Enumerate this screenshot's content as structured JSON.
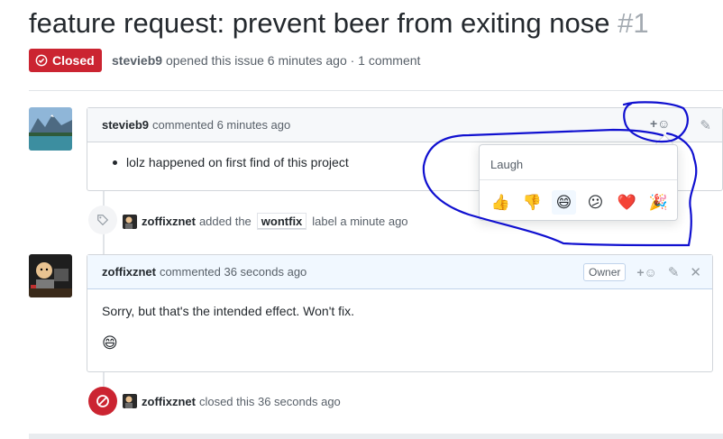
{
  "issue": {
    "title": "feature request: prevent beer from exiting nose",
    "number": "#1",
    "state": "Closed",
    "author": "stevieb9",
    "meta_text": "opened this issue 6 minutes ago · 1 comment"
  },
  "comments": [
    {
      "author": "stevieb9",
      "action": "commented 6 minutes ago",
      "body_list": [
        "lolz happened on first find of this project"
      ]
    },
    {
      "author": "zoffixznet",
      "action": "commented 36 seconds ago",
      "badge": "Owner",
      "body": "Sorry, but that's the intended effect. Won't fix.",
      "reaction_emoji": "😄"
    }
  ],
  "events": {
    "label_event": {
      "actor": "zoffixznet",
      "before": "added the",
      "label": "wontfix",
      "after": "label a minute ago"
    },
    "close_event": {
      "actor": "zoffixznet",
      "text": "closed this 36 seconds ago"
    }
  },
  "reaction_popover": {
    "tooltip": "Laugh",
    "reactions": [
      {
        "name": "thumbs-up",
        "glyph": "👍"
      },
      {
        "name": "thumbs-down",
        "glyph": "👎"
      },
      {
        "name": "laugh",
        "glyph": "😄"
      },
      {
        "name": "confused",
        "glyph": "😕"
      },
      {
        "name": "heart",
        "glyph": "❤️"
      },
      {
        "name": "hooray",
        "glyph": "🎉"
      }
    ]
  },
  "icons": {
    "add_reaction": "+☺",
    "edit": "✎",
    "close": "✕"
  },
  "colors": {
    "closed_red": "#cb2431",
    "scribble_blue": "#1010d0"
  }
}
